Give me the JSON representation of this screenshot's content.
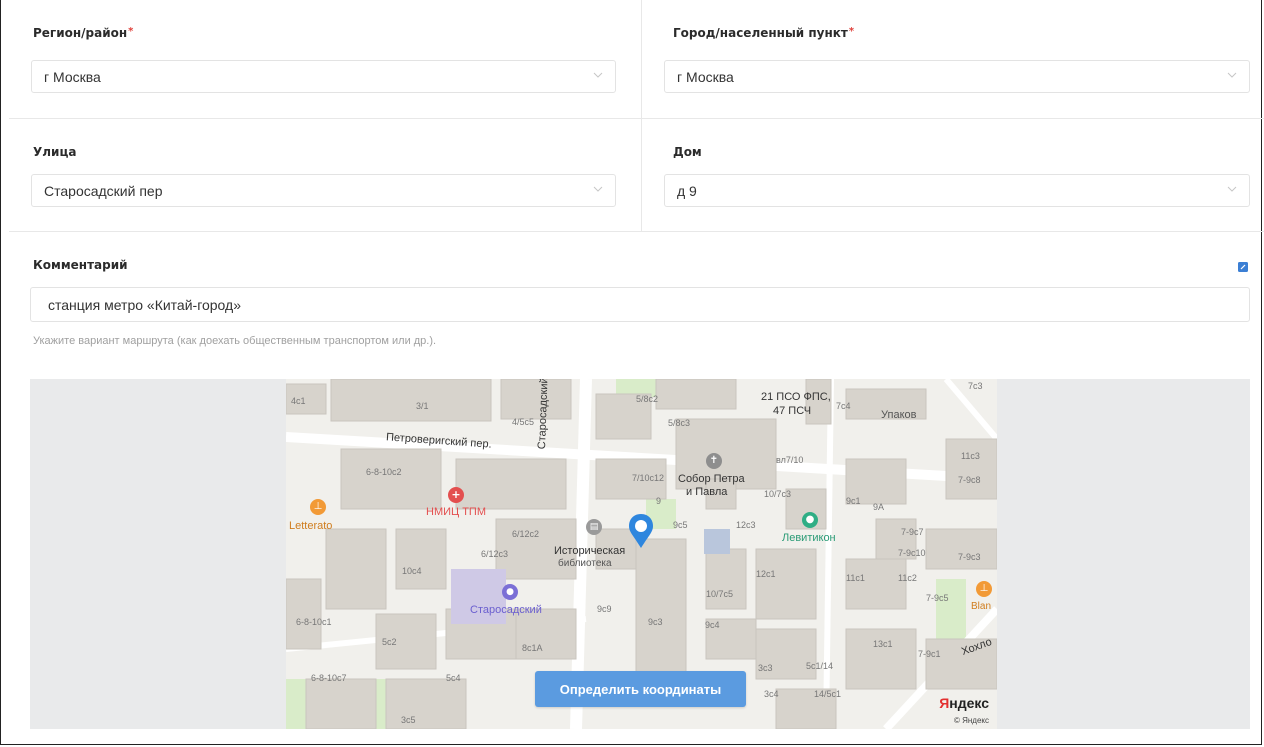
{
  "fields": {
    "region": {
      "label": "Регион/район",
      "required_mark": "*",
      "value": "г Москва"
    },
    "city": {
      "label": "Город/населенный пункт",
      "required_mark": "*",
      "value": "г Москва"
    },
    "street": {
      "label": "Улица",
      "value": "Старосадский пер"
    },
    "house": {
      "label": "Дом",
      "value": "д 9"
    }
  },
  "comment": {
    "label": "Комментарий",
    "value": "станция метро «Китай-город»",
    "hint": "Укажите вариант маршрута (как доехать общественным транспортом или др.)."
  },
  "map": {
    "button_label": "Определить координаты",
    "brand_first": "Я",
    "brand_rest": "ндекс",
    "copyright": "© Яндекс",
    "labels": {
      "street_1": "Петроверигский пер.",
      "street_2": "Старосадский пер.",
      "street_3": "Хохло",
      "poi_church_1": "Собор Петра",
      "poi_church_2": "и Павла",
      "poi_hospital": "НМИЦ ТПМ",
      "poi_library_1": "Историческая",
      "poi_library_2": "библиотека",
      "poi_levitikon": "Левитикон",
      "poi_starosadsky": "Старосадский",
      "poi_letterato": "Letterato",
      "poi_fire_1": "21 ПСО ФПС,",
      "poi_fire_2": "47 ПСЧ",
      "poi_upakov": "Упаков",
      "poi_blan": "Blan"
    },
    "house_numbers": [
      "4с1",
      "3/1",
      "4/5с5",
      "5/8с2",
      "5/8с3",
      "7с3",
      "7с4",
      "11с3",
      "7-9с8",
      "6-8-10с2",
      "7/10с12",
      "9",
      "вл7/10",
      "10/7с3",
      "9с1",
      "9А",
      "7-9с7",
      "7-9с10",
      "7-9с3",
      "6/12с2",
      "6/12с3",
      "9с5",
      "12с3",
      "10с4",
      "12с1",
      "11с1",
      "11с2",
      "7-9с5",
      "10/7с5",
      "9с9",
      "9с3",
      "9с4",
      "6-8-10с1",
      "5с2",
      "8с1А",
      "13с1",
      "7-9с1",
      "3с3",
      "5с1/14",
      "6-8-10с7",
      "5с4",
      "3с4",
      "14/5с1",
      "3с5"
    ]
  },
  "colors": {
    "accent": "#5b9be0",
    "required": "#e0413b",
    "edit_icon": "#3b7fd4",
    "map_pin": "#2e86de"
  },
  "icons": [
    "chevron-down-icon",
    "edit-icon",
    "map-pin-icon",
    "hospital-icon",
    "church-icon",
    "library-icon",
    "cafe-icon",
    "pharmacy-icon"
  ]
}
